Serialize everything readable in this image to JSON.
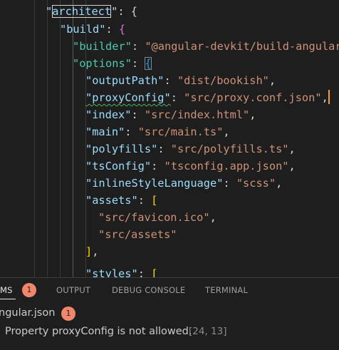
{
  "editor": {
    "lines": {
      "architect_key": "architect",
      "architect_rest": "\": {",
      "build_key": "\"build\"",
      "builder_key": "\"builder\"",
      "builder_value": "\"@angular-devkit/build-angular",
      "options_key": "\"options\"",
      "outputPath_key": "\"outputPath\"",
      "outputPath_value": "\"dist/bookish\"",
      "proxyConfig_key": "\"proxyConfig\"",
      "proxyConfig_value": "\"src/proxy.conf.json\"",
      "index_key": "\"index\"",
      "index_value": "\"src/index.html\"",
      "main_key": "\"main\"",
      "main_value": "\"src/main.ts\"",
      "polyfills_key": "\"polyfills\"",
      "polyfills_value": "\"src/polyfills.ts\"",
      "tsConfig_key": "\"tsConfig\"",
      "tsConfig_value": "\"tsconfig.app.json\"",
      "inlineStyleLanguage_key": "\"inlineStyleLanguage\"",
      "inlineStyleLanguage_value": "\"scss\"",
      "assets_key": "\"assets\"",
      "asset_1": "\"src/favicon.ico\"",
      "asset_2": "\"src/assets\"",
      "styles_key": "\"styles\""
    }
  },
  "panel": {
    "tabs": [
      {
        "label": "MS",
        "active": true
      },
      {
        "label": "OUTPUT",
        "active": false
      },
      {
        "label": "DEBUG CONSOLE",
        "active": false
      },
      {
        "label": "TERMINAL",
        "active": false
      }
    ],
    "problems_count": "1",
    "file": {
      "name": "ngular.json",
      "count": "1"
    },
    "problem": {
      "message": "Property proxyConfig is not allowed.",
      "location": "[24, 13]"
    }
  },
  "colors": {
    "background": "#1e1e1e",
    "badge": "#f0866b",
    "json_key": "#9cdcfe",
    "json_string": "#ce9178",
    "squiggle": "#4db35a",
    "caret": "#ff9b3b"
  }
}
